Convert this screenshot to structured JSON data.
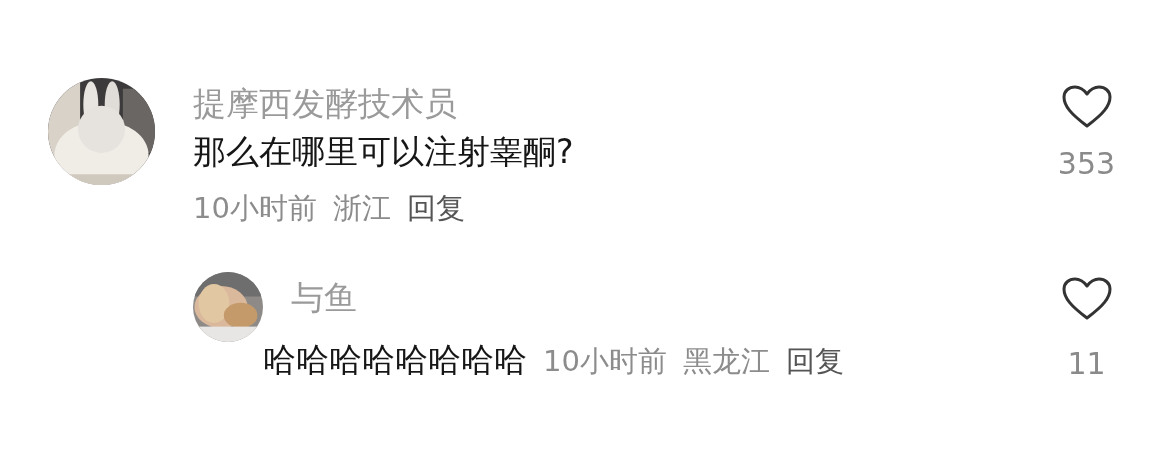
{
  "comments": [
    {
      "author": "提摩西发酵技术员",
      "text": "那么在哪里可以注射睾酮?",
      "time": "10小时前",
      "location": "浙江",
      "reply_label": "回复",
      "likes": "353",
      "replies": [
        {
          "author": "与鱼",
          "text": "哈哈哈哈哈哈哈哈",
          "time": "10小时前",
          "location": "黑龙江",
          "reply_label": "回复",
          "likes": "11"
        }
      ]
    }
  ]
}
